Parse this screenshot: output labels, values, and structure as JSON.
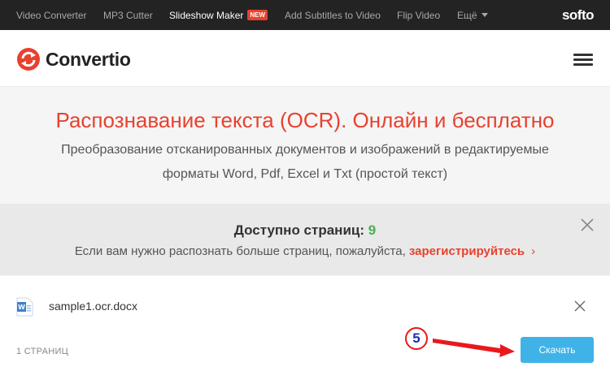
{
  "topbar": {
    "items": [
      {
        "label": "Video Converter"
      },
      {
        "label": "MP3 Cutter"
      },
      {
        "label": "Slideshow Maker",
        "badge": "NEW"
      },
      {
        "label": "Add Subtitles to Video"
      },
      {
        "label": "Flip Video"
      },
      {
        "label": "Ещё"
      }
    ],
    "brand": "softo"
  },
  "header": {
    "logo_text": "Convertio",
    "logo_icon": "convertio-logo-icon",
    "menu_icon": "hamburger-icon"
  },
  "hero": {
    "title": "Распознавание текста (OCR). Онлайн и бесплатно",
    "subtitle_line1": "Преобразование отсканированных документов и изображений в редактируемые",
    "subtitle_line2": "форматы Word, Pdf, Excel и Txt (простой текст)"
  },
  "notice": {
    "title_prefix": "Доступно страниц:",
    "pages_count": "9",
    "text": "Если вам нужно распознать больше страниц, пожалуйста,",
    "link": "зарегистрируйтесь",
    "chevron": "›",
    "close_icon": "close-icon"
  },
  "file": {
    "name": "sample1.ocr.docx",
    "pages_label": "1 СТРАНИЦ",
    "download_label": "Скачать",
    "file_icon": "word-document-icon"
  },
  "annotation": {
    "step": "5"
  },
  "colors": {
    "accent": "#e8412f",
    "button": "#3fb3e8",
    "count": "#4caf50",
    "topbar": "#232323"
  }
}
